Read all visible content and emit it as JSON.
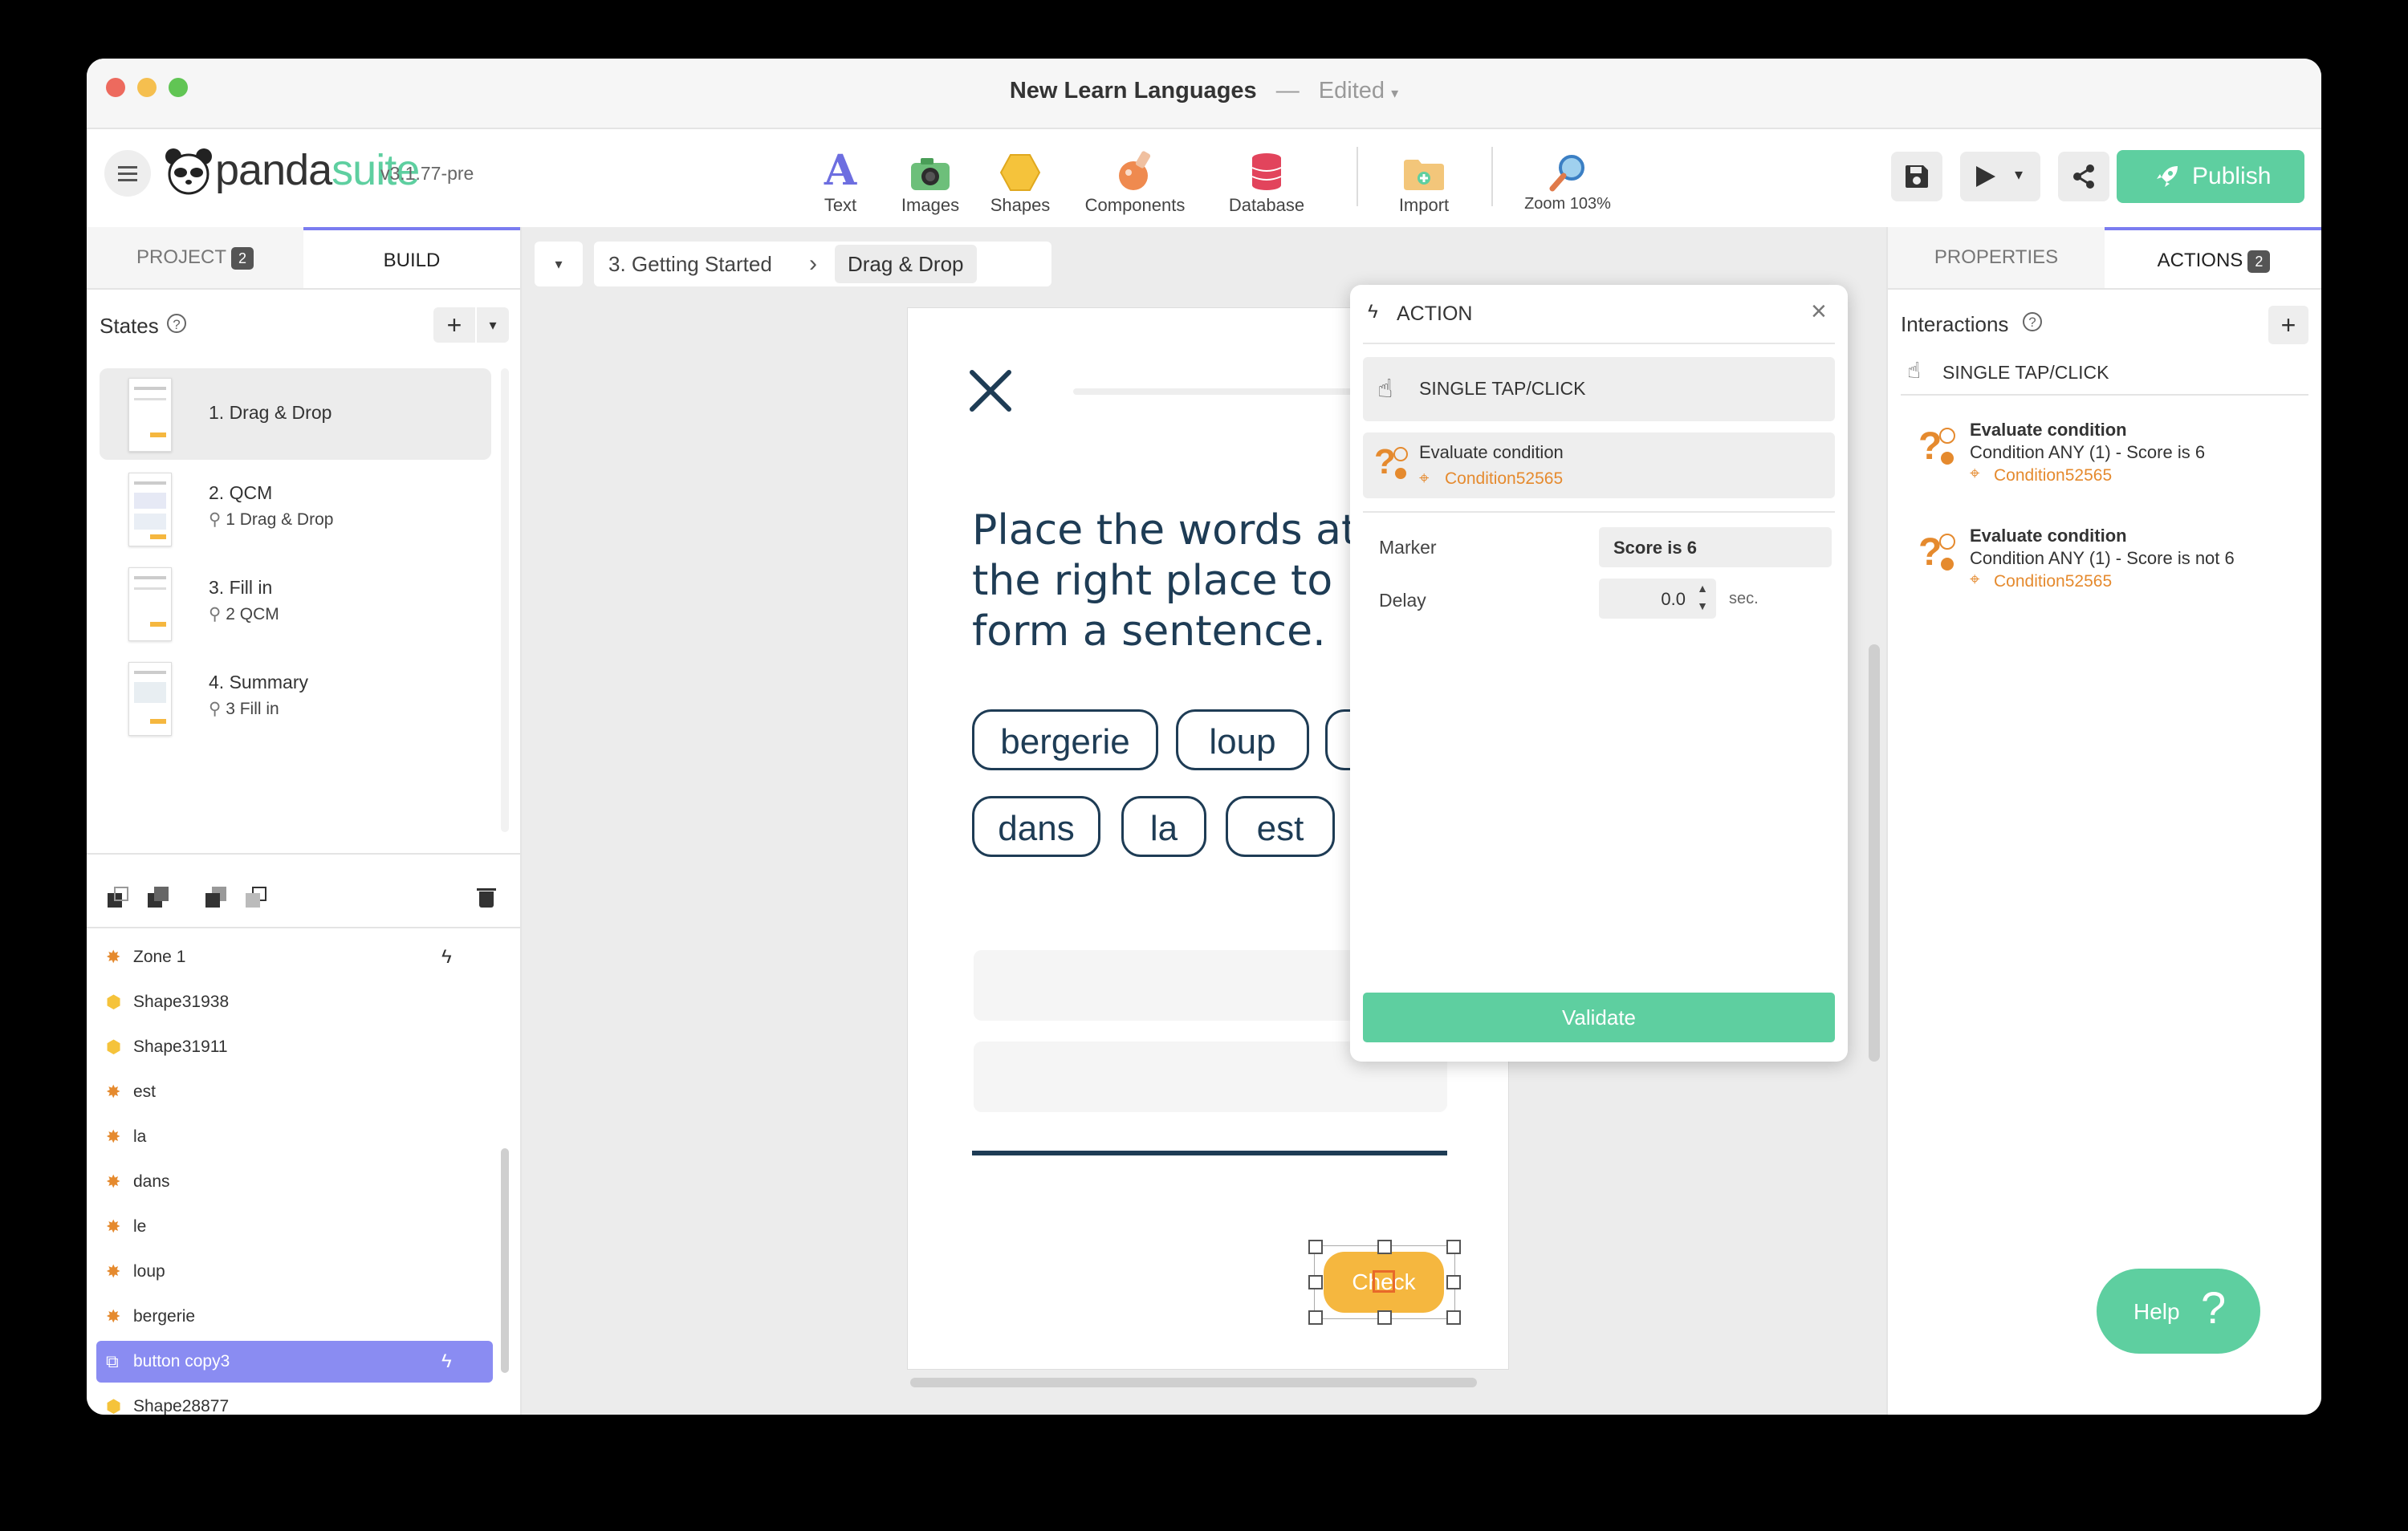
{
  "window": {
    "title": "New Learn Languages",
    "separator": "—",
    "status": "Edited"
  },
  "toolbar": {
    "logo_text": "pandasuite",
    "version": "v3.1.77-pre",
    "tools": [
      {
        "label": "Text",
        "icon": "text-icon"
      },
      {
        "label": "Images",
        "icon": "image-icon"
      },
      {
        "label": "Shapes",
        "icon": "shapes-icon"
      },
      {
        "label": "Components",
        "icon": "components-icon"
      },
      {
        "label": "Database",
        "icon": "database-icon"
      },
      {
        "label": "Import",
        "icon": "import-folder-icon"
      },
      {
        "label": "Zoom 103%",
        "icon": "zoom-icon"
      }
    ],
    "publish_label": "Publish",
    "publish_color": "#5ecfa0"
  },
  "left_panel": {
    "tabs": [
      {
        "label": "PROJECT",
        "badge": "2"
      },
      {
        "label": "BUILD"
      }
    ],
    "states_title": "States",
    "states": [
      {
        "title": "1. Drag & Drop",
        "link": ""
      },
      {
        "title": "2. QCM",
        "link": "1 Drag & Drop"
      },
      {
        "title": "3. Fill in",
        "link": "2 QCM"
      },
      {
        "title": "4. Summary",
        "link": "3 Fill in"
      }
    ],
    "layers": [
      {
        "name": "Zone 1",
        "icon": "component-icon",
        "action": true
      },
      {
        "name": "Shape31938",
        "icon": "shape-icon",
        "action": false
      },
      {
        "name": "Shape31911",
        "icon": "shape-icon",
        "action": false
      },
      {
        "name": "est",
        "icon": "component-icon",
        "action": false
      },
      {
        "name": "la",
        "icon": "component-icon",
        "action": false
      },
      {
        "name": "dans",
        "icon": "component-icon",
        "action": false
      },
      {
        "name": "le",
        "icon": "component-icon",
        "action": false
      },
      {
        "name": "loup",
        "icon": "component-icon",
        "action": false
      },
      {
        "name": "bergerie",
        "icon": "component-icon",
        "action": false
      },
      {
        "name": "button copy3",
        "icon": "button-icon",
        "action": true,
        "selected": true
      },
      {
        "name": "Shape28877",
        "icon": "shape-icon",
        "action": false
      }
    ],
    "selected_color": "#8a8cf2"
  },
  "breadcrumb": {
    "items": [
      "3. Getting Started",
      "Drag & Drop"
    ]
  },
  "canvas_page": {
    "instruction": "Place the words at the right place to form a sentence.",
    "words": [
      "bergerie",
      "loup",
      "dans",
      "la",
      "est"
    ],
    "button_label": "Check",
    "button_color": "#f5b73f"
  },
  "action_popup": {
    "title": "ACTION",
    "trigger": "SINGLE TAP/CLICK",
    "action_name": "Evaluate condition",
    "action_ref": "Condition52565",
    "marker_label": "Marker",
    "marker_value": "Score is 6",
    "delay_label": "Delay",
    "delay_value": "0.0",
    "delay_unit": "sec.",
    "validate_label": "Validate"
  },
  "right_panel": {
    "tabs": [
      {
        "label": "PROPERTIES"
      },
      {
        "label": "ACTIONS",
        "badge": "2"
      }
    ],
    "interactions_title": "Interactions",
    "trigger": "SINGLE TAP/CLICK",
    "actions": [
      {
        "title": "Evaluate condition",
        "detail": "Condition ANY (1) - Score is 6",
        "ref": "Condition52565"
      },
      {
        "title": "Evaluate condition",
        "detail": "Condition ANY (1) - Score is not 6",
        "ref": "Condition52565"
      }
    ]
  },
  "help": {
    "label": "Help",
    "glyph": "?"
  }
}
